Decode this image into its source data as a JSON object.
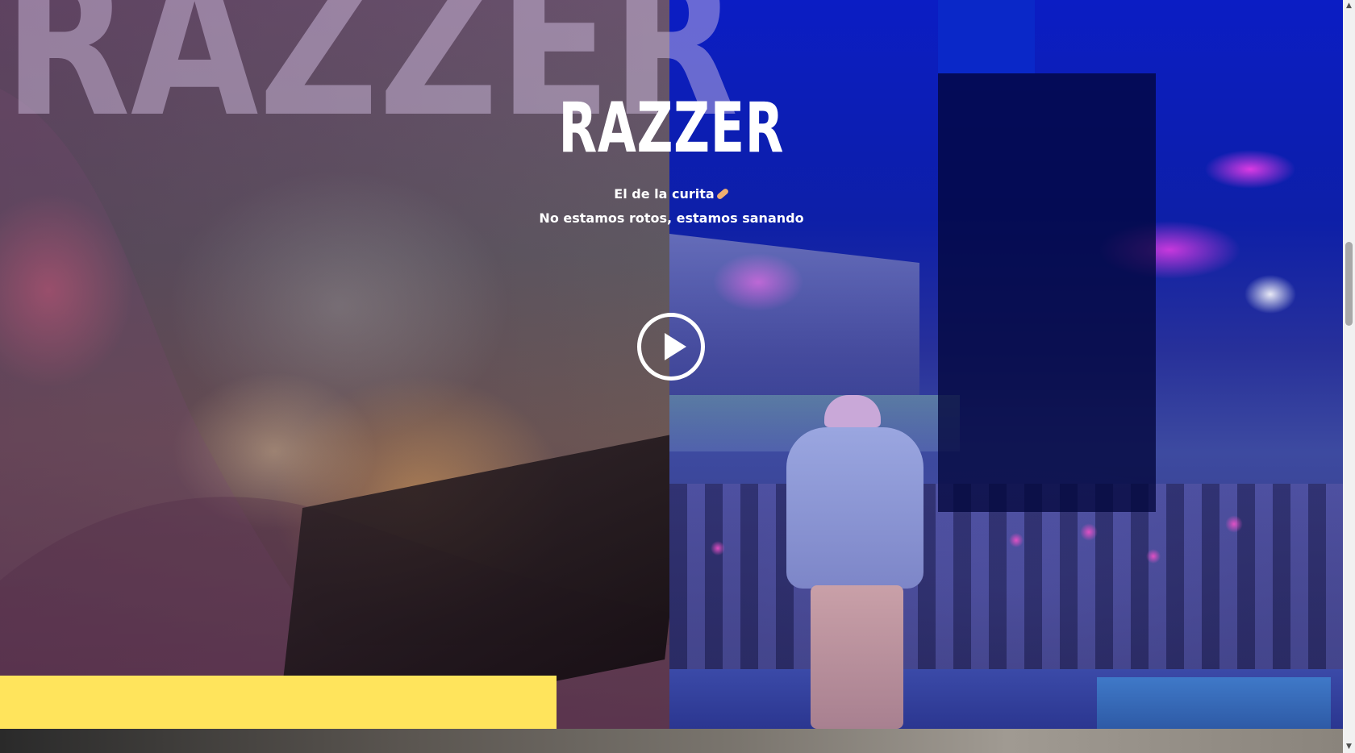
{
  "hero": {
    "background_word": "RAZZER",
    "title": "RAZZER",
    "tagline_line1": "El de la curita",
    "tagline_emoji": "bandage-emoji",
    "tagline_line2": "No estamos rotos, estamos sanando",
    "play_icon": "play-icon"
  },
  "colors": {
    "accent_yellow": "#ffe45c",
    "right_panel_blue": "#0b1dc4",
    "overlay_navy": "#02063c"
  }
}
